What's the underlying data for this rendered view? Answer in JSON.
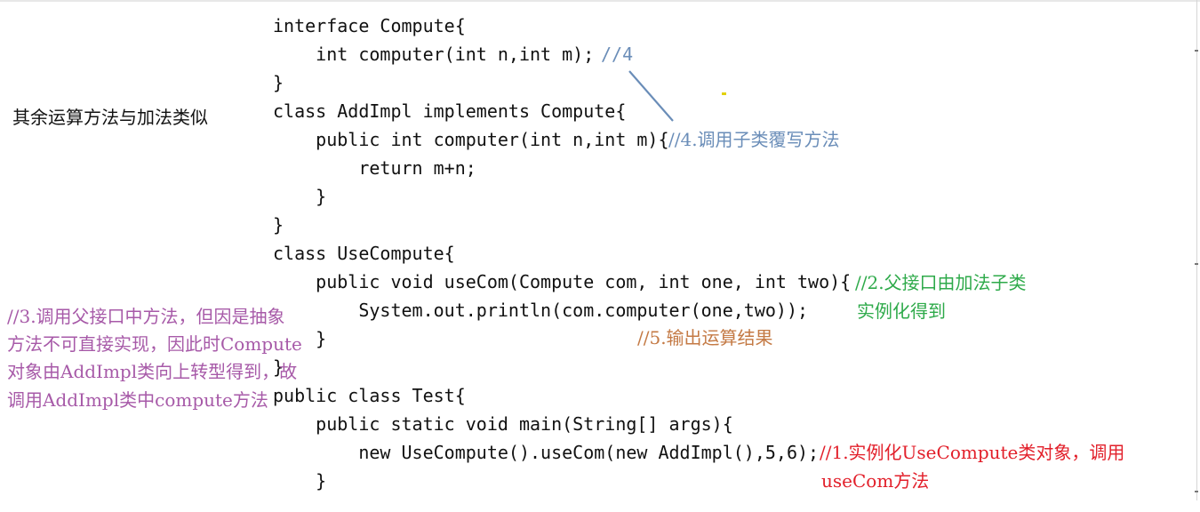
{
  "code": {
    "lines": [
      "interface Compute{",
      "    int computer(int n,int m); ",
      "}",
      "class AddImpl implements Compute{",
      "    public int computer(int n,int m){",
      "        return m+n;",
      "    }",
      "}",
      "class UseCompute{",
      "    public void useCom(Compute com, int one, int two){",
      "        System.out.println(com.computer(one,two));",
      "    }",
      "}",
      "public class Test{",
      "    public static void main(String[] args){",
      "        new UseCompute().useCom(new AddImpl(),5,6);",
      "    }"
    ]
  },
  "notes": {
    "side_note": "其余运算方法与加法类似",
    "note4_tag": "//4",
    "note4_text": "//4.调用子类覆写方法",
    "note2_line1": "//2.父接口由加法子类",
    "note2_line2": "实例化得到",
    "note5": "//5.输出运算结果",
    "note3_line1": "//3.调用父接口中方法，但因是抽象",
    "note3_line2": "方法不可直接实现，因此时Compute",
    "note3_line3": "对象由AddImpl类向上转型得到，故",
    "note3_line4": "调用AddImpl类中compute方法",
    "note1_line1": "//1.实例化UseCompute类对象，调用",
    "note1_line2": "useCom方法"
  },
  "colors": {
    "code_text": "#111111",
    "note4": "#6a8db8",
    "note2": "#2eaa4a",
    "note5": "#c47a45",
    "note1": "#e21f2a",
    "note3": "#a75aa8",
    "arrow": "#6a8db8"
  }
}
